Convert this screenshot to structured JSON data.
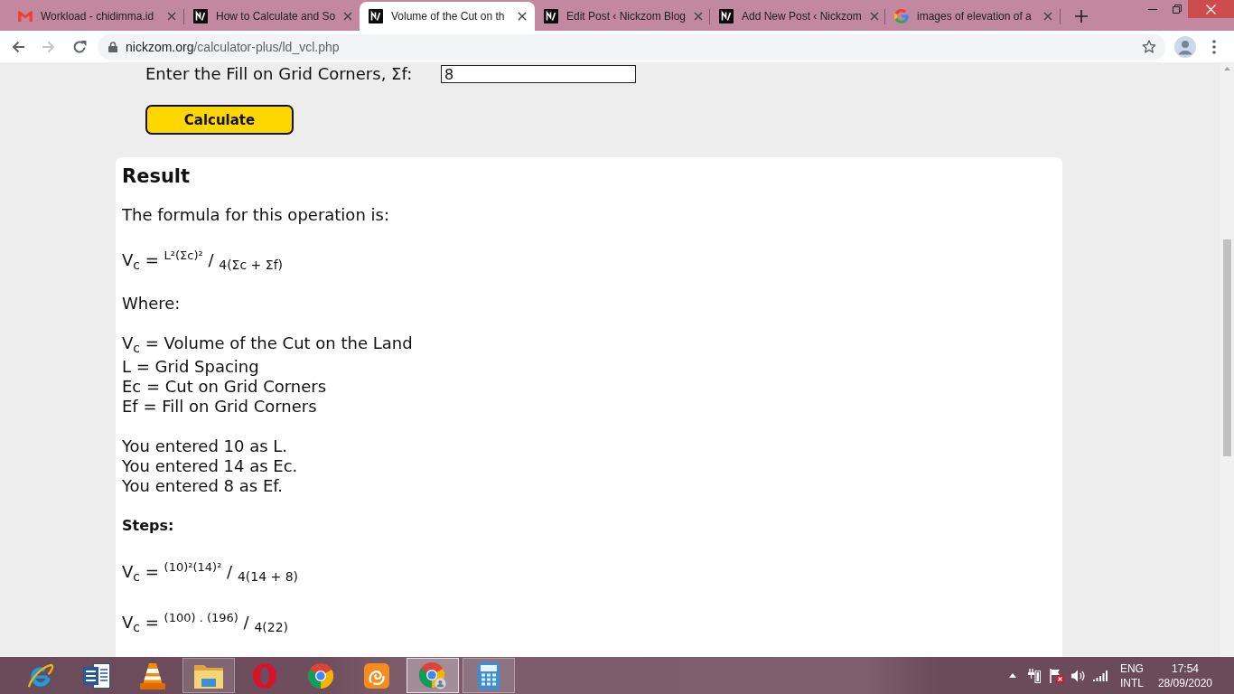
{
  "browser": {
    "tabs": [
      {
        "kind": "mail",
        "title": "Workload - chidimma.id",
        "selected": false
      },
      {
        "kind": "site",
        "title": "How to Calculate and So",
        "selected": false
      },
      {
        "kind": "site",
        "title": "Volume of the Cut on th",
        "selected": true
      },
      {
        "kind": "site",
        "title": "Edit Post ‹ Nickzom Blog",
        "selected": false
      },
      {
        "kind": "site",
        "title": "Add New Post ‹ Nickzom",
        "selected": false
      },
      {
        "kind": "search",
        "title": "images of elevation of a",
        "selected": false
      }
    ],
    "nav_buttons": [
      {
        "kind": "back",
        "disabled": false
      },
      {
        "kind": "forward",
        "disabled": true
      },
      {
        "kind": "reload",
        "disabled": false
      }
    ],
    "address": {
      "host": "nickzom.org",
      "path": "/calculator-plus/ld_vcl.php"
    }
  },
  "page": {
    "form": {
      "label": "Enter the Fill on Grid Corners, Σf:",
      "value": "8",
      "button": "Calculate"
    },
    "result": {
      "title": "Result",
      "intro": "The formula for this operation is:",
      "formula": "V$_{c}$ = $^{L²(Σc)²}$ / $_{4(Σc + Σf)}$",
      "where_label": "Where:",
      "definitions": [
        "V$_{c}$ = Volume of the Cut on the Land",
        "L = Grid Spacing",
        "Ec = Cut on Grid Corners",
        "Ef = Fill on Grid Corners"
      ],
      "entered": [
        "You entered 10 as L.",
        "You entered 14 as Ec.",
        "You entered 8 as Ef."
      ],
      "steps_label": "Steps:",
      "steps": [
        "V$_{c}$ = $^{(10)²(14)²}$ / $_{4(14 + 8)}$",
        "V$_{c}$ = $^{(100) . (196)}$ / $_{4(22)}$"
      ]
    }
  },
  "taskbar": {
    "apps": [
      {
        "kind": "ie",
        "open": false,
        "selected": false
      },
      {
        "kind": "word",
        "open": false,
        "selected": false
      },
      {
        "kind": "vlc",
        "open": false,
        "selected": false
      },
      {
        "kind": "explorer",
        "open": true,
        "selected": false
      },
      {
        "kind": "opera",
        "open": false,
        "selected": false
      },
      {
        "kind": "chrome",
        "open": false,
        "selected": false
      },
      {
        "kind": "ucbrowser",
        "open": false,
        "selected": false
      },
      {
        "kind": "chromeuser",
        "open": true,
        "selected": true
      },
      {
        "kind": "calculator",
        "open": true,
        "selected": false
      }
    ],
    "tray": {
      "language": "ENG",
      "layout": "INTL",
      "time": "17:54",
      "date": "28/09/2020"
    }
  }
}
